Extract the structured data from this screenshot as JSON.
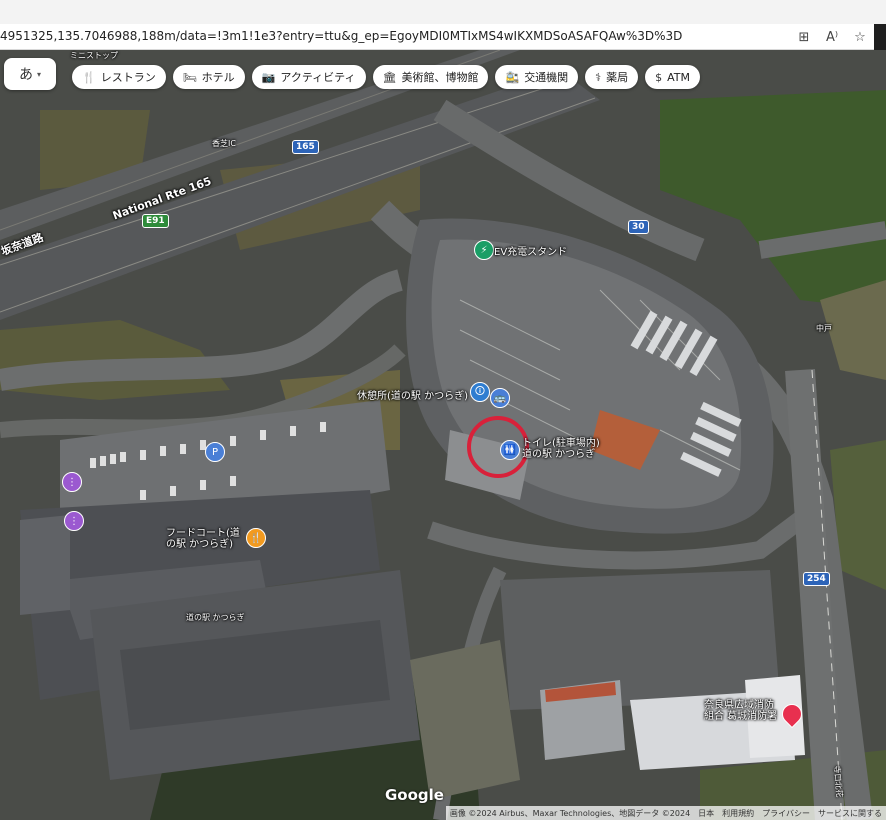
{
  "browser": {
    "url": "4951325,135.7046988,188m/data=!3m1!1e3?entry=ttu&g_ep=EgoyMDI0MTIxMS4wIKXMDSoASAFQAw%3D%3D",
    "icons": [
      "reader-view-icon",
      "read-aloud-icon",
      "favorite-star-icon"
    ]
  },
  "ime": {
    "label": "あ"
  },
  "categories": [
    {
      "label": "レストラン",
      "icon": "restaurant-icon",
      "glyph": "🍴"
    },
    {
      "label": "ホテル",
      "icon": "hotel-icon",
      "glyph": "🛏"
    },
    {
      "label": "アクティビティ",
      "icon": "camera-icon",
      "glyph": "📷"
    },
    {
      "label": "美術館、博物館",
      "icon": "museum-icon",
      "glyph": "🏛"
    },
    {
      "label": "交通機関",
      "icon": "transit-icon",
      "glyph": "🚉"
    },
    {
      "label": "薬局",
      "icon": "pharmacy-icon",
      "glyph": "⚕"
    },
    {
      "label": "ATM",
      "icon": "atm-icon",
      "glyph": "$"
    }
  ],
  "map_labels": {
    "road_national": "National Rte 165",
    "road_keinawa": "坂奈道路",
    "road_north": "香芝IC",
    "route_165": "165",
    "route_e91": "E91",
    "route_30": "30",
    "route_254": "254",
    "ev": "EV充電スタンド",
    "rest_area": "休憩所(道の駅 かつらぎ)",
    "toilet": "トイレ(駐車場内)\n道の駅 かつらぎ",
    "food_court": "フードコート(道\nの駅 かつらぎ)",
    "michinoeki": "道の駅 かつらぎ",
    "nakado": "中戸",
    "store_top": "ミニストップ",
    "fire_dept": "奈良県広域消防\n組合 葛城消防署",
    "side_road": "寺口北花"
  },
  "footer": {
    "google": "Google",
    "attribution": "画像 ©2024 Airbus、Maxar Technologies、地図データ ©2024",
    "japan": "日本",
    "terms": "利用規約",
    "privacy": "プライバシー",
    "feedback": "サービスに関する"
  }
}
